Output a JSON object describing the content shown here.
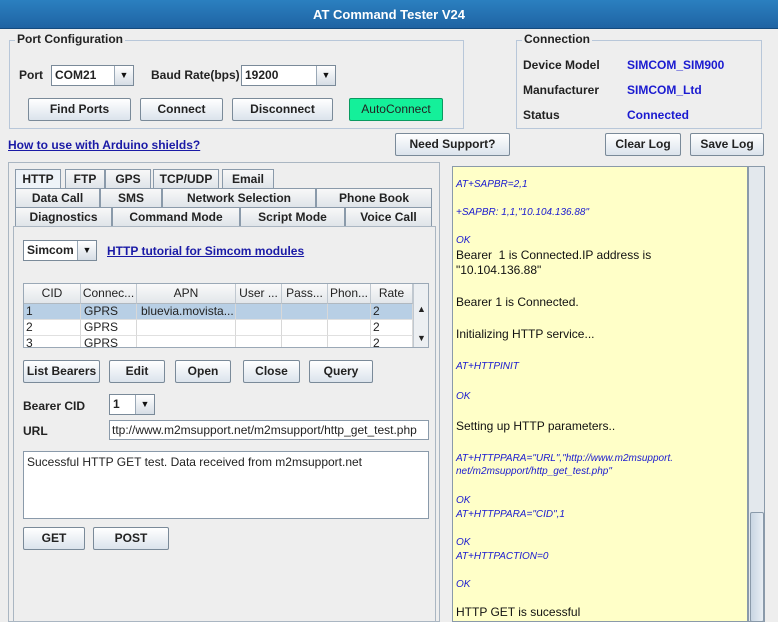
{
  "window": {
    "title": "AT Command Tester V24"
  },
  "port_config": {
    "title": "Port Configuration",
    "port_label": "Port",
    "port_value": "COM21",
    "baud_label": "Baud Rate(bps)",
    "baud_value": "19200",
    "find_ports": "Find Ports",
    "connect": "Connect",
    "disconnect": "Disconnect",
    "autoconnect": "AutoConnect"
  },
  "connection": {
    "title": "Connection",
    "device_model_label": "Device Model",
    "device_model": "SIMCOM_SIM900",
    "manufacturer_label": "Manufacturer",
    "manufacturer": "SIMCOM_Ltd",
    "status_label": "Status",
    "status": "Connected"
  },
  "links": {
    "arduino": "How to use with Arduino shields?",
    "need_support": "Need Support?",
    "clear_log": "Clear Log",
    "save_log": "Save Log"
  },
  "tabs": {
    "row1": [
      "HTTP",
      "FTP",
      "GPS",
      "TCP/UDP",
      "Email"
    ],
    "row2": [
      "Data Call",
      "SMS",
      "Network Selection",
      "Phone Book"
    ],
    "row3": [
      "Diagnostics",
      "Command Mode",
      "Script Mode",
      "Voice Call"
    ]
  },
  "http": {
    "module_value": "Simcom",
    "tutorial_link": "HTTP tutorial for Simcom modules",
    "columns": [
      "CID",
      "Connec...",
      "APN",
      "User ...",
      "Pass...",
      "Phon...",
      "Rate"
    ],
    "rows": [
      [
        "1",
        "GPRS",
        "bluevia.movista...",
        "",
        "",
        "",
        "2"
      ],
      [
        "2",
        "GPRS",
        "",
        "",
        "",
        "",
        "2"
      ],
      [
        "3",
        "GPRS",
        "",
        "",
        "",
        "",
        "2"
      ]
    ],
    "list_bearers": "List Bearers",
    "edit": "Edit",
    "open": "Open",
    "close": "Close",
    "query": "Query",
    "bearer_cid_label": "Bearer CID",
    "bearer_cid_value": "1",
    "url_label": "URL",
    "url_value": "ttp://www.m2msupport.net/m2msupport/http_get_test.php",
    "response": "Sucessful HTTP GET test. Data received from m2msupport.net",
    "get": "GET",
    "post": "POST"
  },
  "log": [
    {
      "type": "cmd",
      "text": "AT+SAPBR=2,1"
    },
    {
      "type": "cmd",
      "text": "+SAPBR: 1,1,\"10.104.136.88\""
    },
    {
      "type": "cmd",
      "text": "OK"
    },
    {
      "type": "msg",
      "text": "Bearer  1 is Connected.IP address is"
    },
    {
      "type": "msg",
      "text": "\"10.104.136.88\""
    },
    {
      "type": "msg",
      "text": "Bearer 1 is Connected."
    },
    {
      "type": "msg",
      "text": "Initializing HTTP service..."
    },
    {
      "type": "cmd",
      "text": "AT+HTTPINIT"
    },
    {
      "type": "cmd",
      "text": "OK"
    },
    {
      "type": "msg",
      "text": "Setting up HTTP parameters.."
    },
    {
      "type": "cmd",
      "text": "AT+HTTPPARA=\"URL\",\"http://www.m2msupport."
    },
    {
      "type": "cmd",
      "text": "net/m2msupport/http_get_test.php\""
    },
    {
      "type": "cmd",
      "text": "OK"
    },
    {
      "type": "cmd",
      "text": "AT+HTTPPARA=\"CID\",1"
    },
    {
      "type": "cmd",
      "text": "OK"
    },
    {
      "type": "cmd",
      "text": "AT+HTTPACTION=0"
    },
    {
      "type": "cmd",
      "text": "OK"
    },
    {
      "type": "msg",
      "text": "HTTP GET is sucessful"
    }
  ]
}
